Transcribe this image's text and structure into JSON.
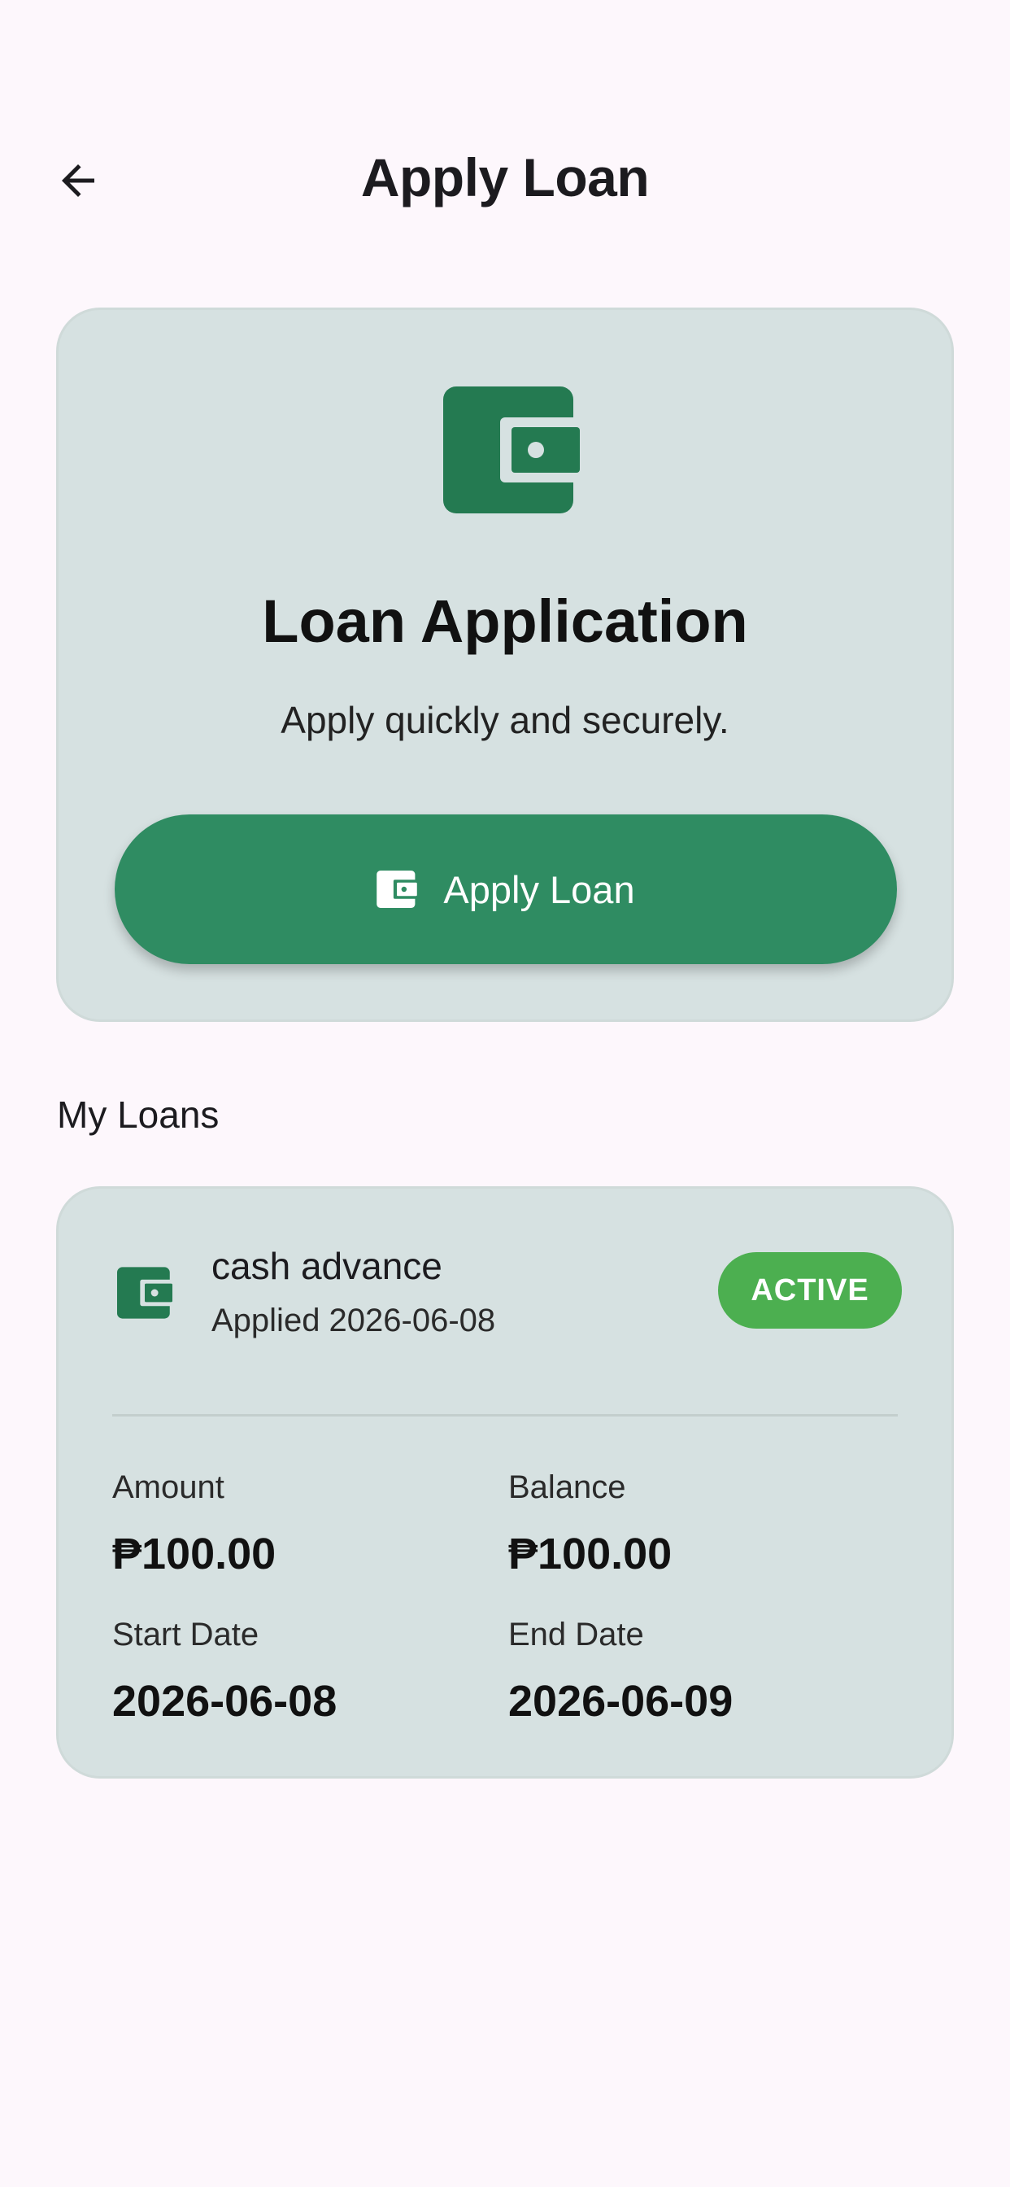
{
  "header": {
    "title": "Apply Loan",
    "back_icon": "arrow-left-icon"
  },
  "apply_card": {
    "icon": "wallet-icon",
    "title": "Loan Application",
    "subtitle": "Apply quickly and securely.",
    "button_label": "Apply Loan",
    "button_icon": "wallet-icon"
  },
  "my_loans": {
    "section_title": "My Loans",
    "loans": [
      {
        "name": "cash advance",
        "applied": "Applied 2026-06-08",
        "status": "ACTIVE",
        "amount_label": "Amount",
        "amount": "₱100.00",
        "balance_label": "Balance",
        "balance": "₱100.00",
        "start_label": "Start Date",
        "start_date": "2026-06-08",
        "end_label": "End Date",
        "end_date": "2026-06-09"
      }
    ]
  },
  "colors": {
    "background": "#fdf7fc",
    "card": "#d6e1e1",
    "primary_green": "#2f8c62",
    "wallet_green": "#247a51",
    "status_green": "#4caf50"
  }
}
